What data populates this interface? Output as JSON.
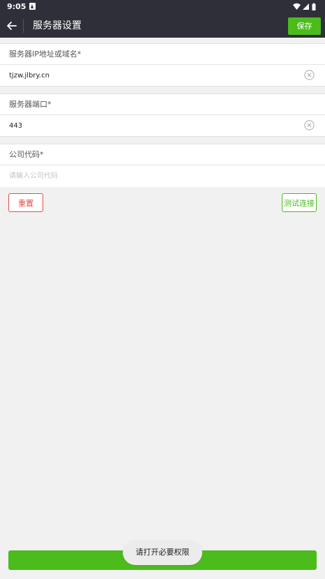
{
  "status_bar": {
    "time": "9:05",
    "icons": [
      "notification-a-icon",
      "wifi-icon",
      "cell-signal-icon",
      "battery-icon"
    ]
  },
  "app_bar": {
    "title": "服务器设置",
    "save_label": "保存"
  },
  "form": {
    "server_address": {
      "label": "服务器IP地址或域名*",
      "value": "tjzw.jlbry.cn",
      "placeholder": ""
    },
    "server_port": {
      "label": "服务器端口*",
      "value": "443",
      "placeholder": ""
    },
    "company_code": {
      "label": "公司代码*",
      "value": "",
      "placeholder": "请输入公司代码"
    }
  },
  "actions": {
    "reset_label": "重置",
    "test_label": "测试连接"
  },
  "toast": {
    "message": "请打开必要权限"
  },
  "colors": {
    "accent": "#4cbb1c",
    "danger": "#e84a4a",
    "bar": "#2f2f39"
  }
}
